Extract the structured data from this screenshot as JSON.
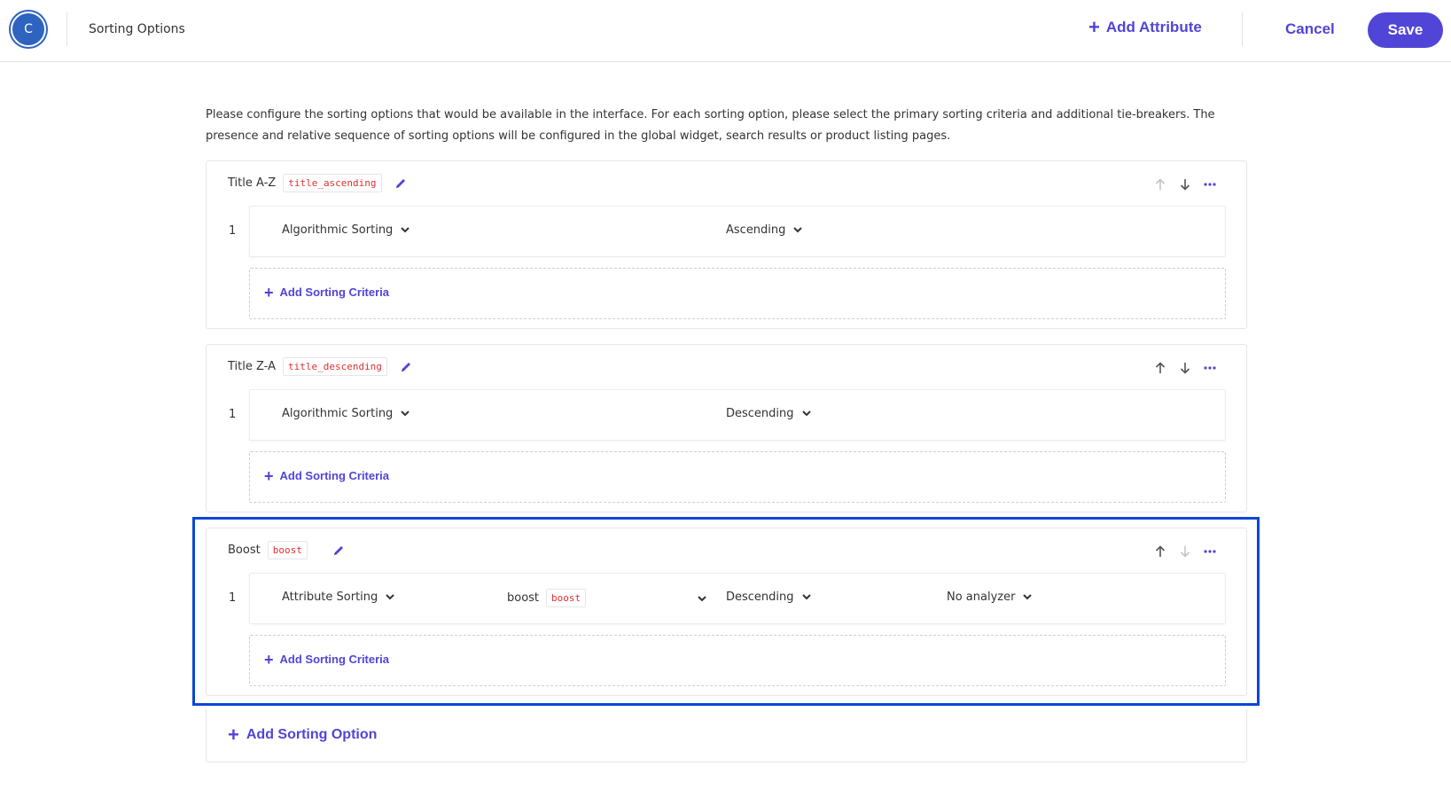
{
  "header": {
    "avatar_letter": "C",
    "title": "Sorting Options",
    "add_attribute_label": "Add Attribute",
    "cancel_label": "Cancel",
    "save_label": "Save"
  },
  "description": "Please configure the sorting options that would be available in the interface. For each sorting option, please select the primary sorting criteria and additional tie-breakers. The presence and relative sequence of sorting options will be configured in the global widget, search results or product listing pages.",
  "options": [
    {
      "name": "Title A-Z",
      "key": "title_ascending",
      "criteria": [
        {
          "index": "1",
          "type": "Algorithmic Sorting",
          "order": "Ascending"
        }
      ],
      "add_criteria_label": "Add Sorting Criteria"
    },
    {
      "name": "Title Z-A",
      "key": "title_descending",
      "criteria": [
        {
          "index": "1",
          "type": "Algorithmic Sorting",
          "order": "Descending"
        }
      ],
      "add_criteria_label": "Add Sorting Criteria"
    },
    {
      "name": "Boost",
      "key": "boost",
      "criteria": [
        {
          "index": "1",
          "type": "Attribute Sorting",
          "attribute_name": "boost",
          "attribute_key": "boost",
          "order": "Descending",
          "analyzer": "No analyzer"
        }
      ],
      "add_criteria_label": "Add Sorting Criteria"
    }
  ],
  "add_sorting_option_label": "Add Sorting Option",
  "colors": {
    "accent": "#5045d6",
    "key_text": "#e03131",
    "highlight_border": "#0b46d8",
    "avatar": "#2f63c0"
  }
}
